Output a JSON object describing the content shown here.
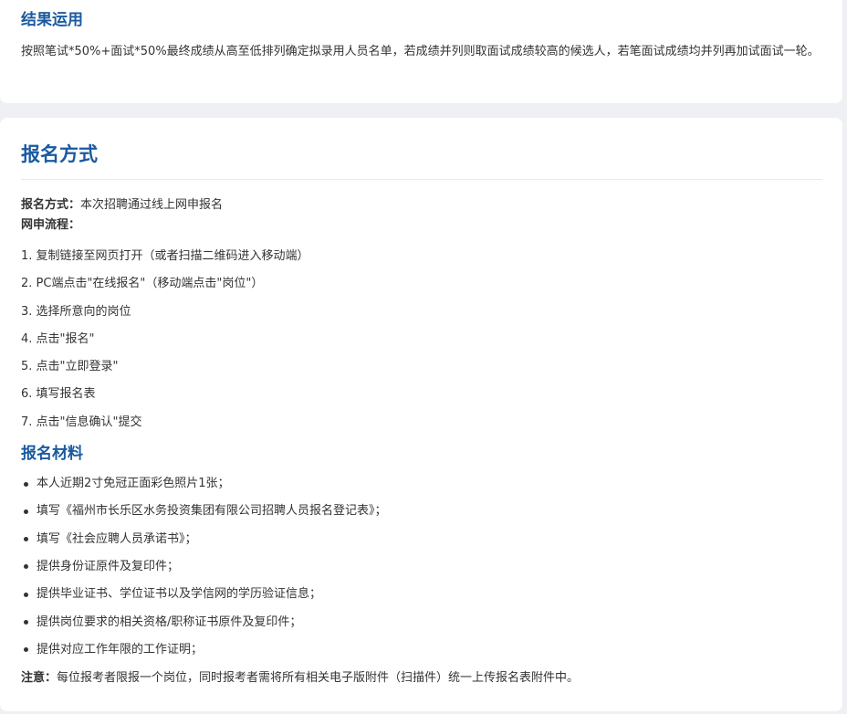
{
  "results": {
    "title": "结果运用",
    "text": "按照笔试*50%+面试*50%最终成绩从高至低排列确定拟录用人员名单，若成绩并列则取面试成绩较高的候选人，若笔面试成绩均并列再加试面试一轮。"
  },
  "registration": {
    "title": "报名方式",
    "method_label": "报名方式：",
    "method_value": "本次招聘通过线上网申报名",
    "flow_label": "网申流程：",
    "steps": [
      "1. 复制链接至网页打开（或者扫描二维码进入移动端）",
      "2. PC端点击\"在线报名\"（移动端点击\"岗位\"）",
      "3. 选择所意向的岗位",
      "4. 点击\"报名\"",
      "5. 点击\"立即登录\"",
      "6. 填写报名表",
      "7. 点击\"信息确认\"提交"
    ],
    "materials_title": "报名材料",
    "materials": [
      "本人近期2寸免冠正面彩色照片1张；",
      "填写《福州市长乐区水务投资集团有限公司招聘人员报名登记表》；",
      "填写《社会应聘人员承诺书》；",
      "提供身份证原件及复印件；",
      "提供毕业证书、学位证书以及学信网的学历验证信息；",
      "提供岗位要求的相关资格/职称证书原件及复印件；",
      "提供对应工作年限的工作证明；"
    ],
    "notice_label": "注意：",
    "notice_text": "每位报考者限报一个岗位，同时报考者需将所有相关电子版附件（扫描件）统一上传报名表附件中。"
  }
}
